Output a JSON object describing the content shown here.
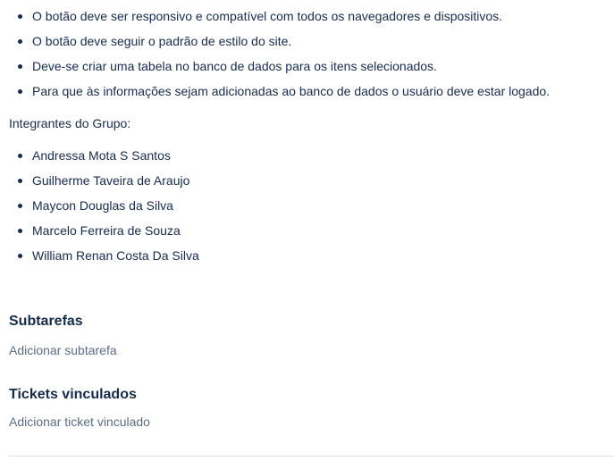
{
  "requirements": [
    "O botão deve ser responsivo e compatível com todos os navegadores e dispositivos.",
    "O botão deve seguir o padrão de estilo do site.",
    "Deve-se criar uma tabela no banco de dados para os itens selecionados.",
    "Para que às informações sejam adicionadas ao banco de dados o usuário deve estar logado."
  ],
  "group": {
    "label": "Integrantes do Grupo:",
    "members": [
      "Andressa Mota S Santos",
      "Guilherme Taveira de Araujo",
      "Maycon Douglas da Silva",
      "Marcelo Ferreira de Souza",
      "William Renan Costa Da Silva"
    ]
  },
  "subtasks": {
    "title": "Subtarefas",
    "add_label": "Adicionar subtarefa"
  },
  "linked_tickets": {
    "title": "Tickets vinculados",
    "add_label": "Adicionar ticket vinculado"
  },
  "colors": {
    "text": "#172b4d",
    "muted": "#5e6c84",
    "divider": "#dfe1e6"
  }
}
